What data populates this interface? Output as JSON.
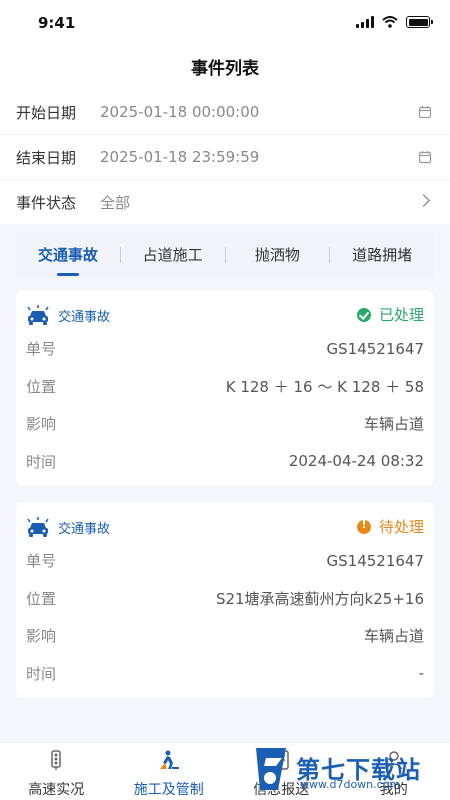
{
  "status_bar": {
    "time": "9:41"
  },
  "page_title": "事件列表",
  "filters": {
    "start": {
      "label": "开始日期",
      "value": "2025-01-18 00:00:00"
    },
    "end": {
      "label": "结束日期",
      "value": "2025-01-18 23:59:59"
    },
    "status": {
      "label": "事件状态",
      "value": "全部"
    }
  },
  "tabs": [
    "交通事故",
    "占道施工",
    "抛洒物",
    "道路拥堵"
  ],
  "cards": [
    {
      "type": "交通事故",
      "status": "已处理",
      "rows": [
        {
          "k": "单号",
          "v": "GS14521647"
        },
        {
          "k": "位置",
          "v": "K 128 ＋ 16 ～ K 128 ＋ 58"
        },
        {
          "k": "影响",
          "v": "车辆占道"
        },
        {
          "k": "时间",
          "v": "2024-04-24 08:32"
        }
      ]
    },
    {
      "type": "交通事故",
      "status": "待处理",
      "rows": [
        {
          "k": "单号",
          "v": "GS14521647"
        },
        {
          "k": "位置",
          "v": "S21塘承高速蓟州方向k25+16"
        },
        {
          "k": "影响",
          "v": "车辆占道"
        },
        {
          "k": "时间",
          "v": "-"
        }
      ]
    }
  ],
  "tabbar": [
    "高速实况",
    "施工及管制",
    "信息报送",
    "我的"
  ],
  "watermark": {
    "title": "第七下载站",
    "url": "www.d7down.com"
  },
  "colors": {
    "accent": "#1a5fb4",
    "done": "#2aa86a",
    "pending": "#e8891c"
  }
}
